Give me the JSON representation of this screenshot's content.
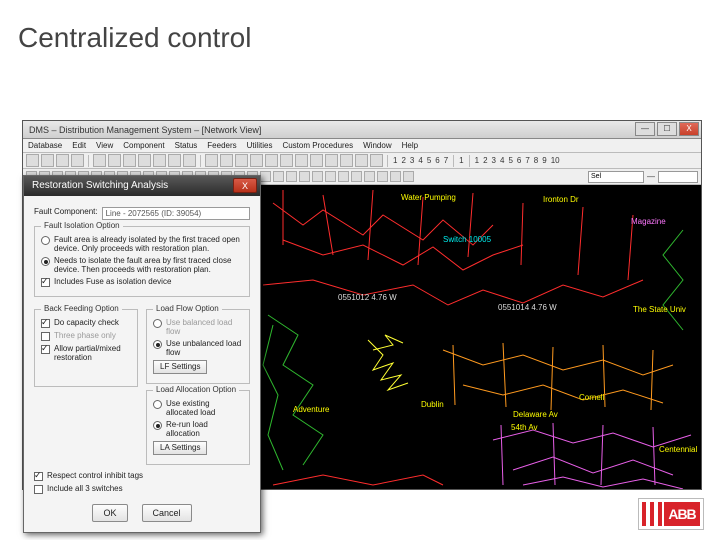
{
  "slide": {
    "title": "Centralized control"
  },
  "logo": {
    "text": "ABB"
  },
  "window": {
    "title": "DMS – Distribution Management System – [Network View]",
    "minimize": "—",
    "maximize": "☐",
    "close": "X"
  },
  "menu": [
    "Database",
    "Edit",
    "View",
    "Component",
    "Status",
    "Feeders",
    "Utilities",
    "Custom Procedures",
    "Window",
    "Help"
  ],
  "toolbar2_nums": [
    "1",
    "2",
    "3",
    "4",
    "5",
    "6",
    "7",
    "1",
    "1",
    "2",
    "3",
    "4",
    "5",
    "6",
    "7",
    "8",
    "9",
    "10"
  ],
  "toolbar3": {
    "sel_label": "Sel",
    "dash": "—"
  },
  "map_labels": {
    "water_pumping": "Water Pumping",
    "ironton_dr": "Ironton Dr",
    "magazine": "Magazine",
    "switch": "Switch 10005",
    "node_a": "0551012  4.76 W",
    "node_b": "0551014  4.76 W",
    "the_state_univ": "The State Univ",
    "dublin": "Dublin",
    "adventure": "Adventure",
    "delaware": "Delaware Av",
    "fifth": "54th Av",
    "cornell": "Cornell",
    "centennial": "Centennial"
  },
  "dialog": {
    "title": "Restoration Switching Analysis",
    "close": "X",
    "fault_component_label": "Fault Component:",
    "fault_component_value": "Line - 2072565 (ID: 39054)",
    "fault_isolation_legend": "Fault Isolation Option",
    "opt_already_isolated": "Fault area is already isolated by the first traced open device. Only proceeds with restoration plan.",
    "opt_needs_isolate": "Needs to isolate the fault area by first traced close device. Then proceeds with restoration plan.",
    "chk_include_fuse": "Includes Fuse as isolation device",
    "back_feeding_legend": "Back Feeding Option",
    "chk_capacity": "Do capacity check",
    "chk_three_phase": "Three phase only",
    "chk_allow_partial": "Allow partial/mixed restoration",
    "load_flow_legend": "Load Flow Option",
    "rad_balanced": "Use balanced load flow",
    "rad_unbalanced": "Use unbalanced load flow",
    "btn_lf_settings": "LF Settings",
    "load_alloc_legend": "Load Allocation Option",
    "rad_existing_alloc": "Use existing allocated load",
    "rad_rerun_alloc": "Re-run load allocation",
    "btn_la_settings": "LA Settings",
    "chk_respect_inhibit": "Respect control inhibit tags",
    "chk_include_all3": "Include all 3 switches",
    "btn_ok": "OK",
    "btn_cancel": "Cancel"
  }
}
